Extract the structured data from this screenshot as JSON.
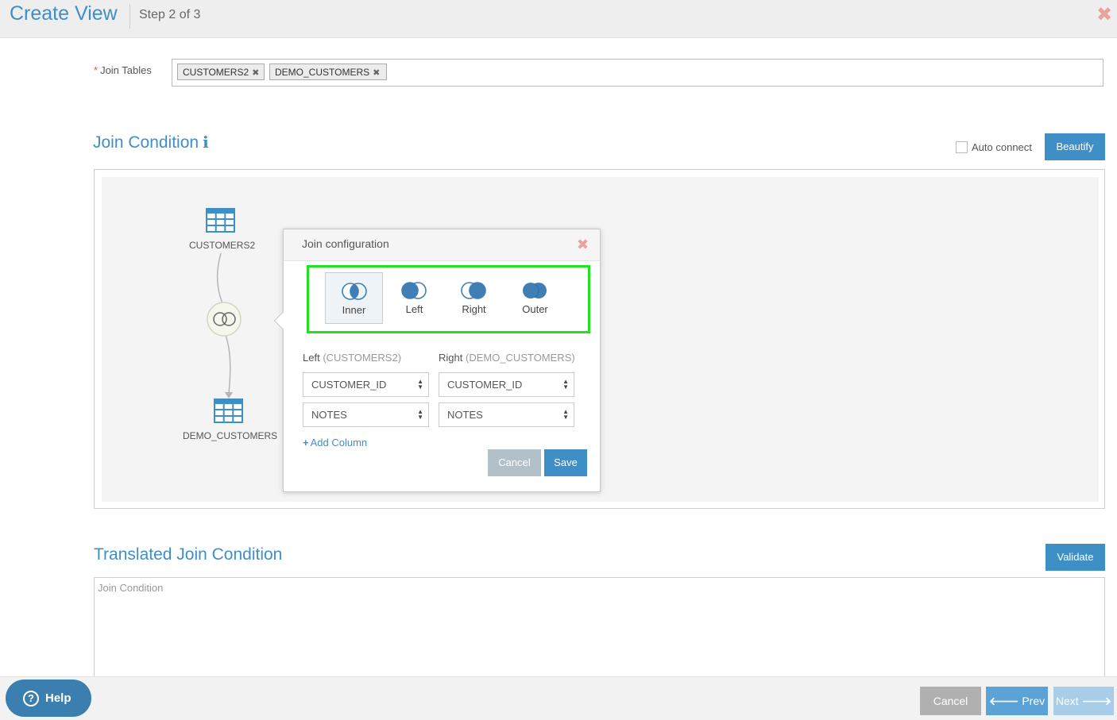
{
  "header": {
    "title": "Create View",
    "step": "Step 2 of 3",
    "close_icon": "close-icon"
  },
  "join_tables": {
    "required_mark": "*",
    "label": "Join Tables",
    "tags": [
      {
        "label": "CUSTOMERS2"
      },
      {
        "label": "DEMO_CUSTOMERS"
      }
    ]
  },
  "join_condition": {
    "title": "Join Condition",
    "auto_connect_label": "Auto connect",
    "auto_connect_checked": false,
    "beautify_label": "Beautify",
    "nodes": {
      "left_table": "CUSTOMERS2",
      "right_table": "DEMO_CUSTOMERS"
    }
  },
  "join_config": {
    "title": "Join configuration",
    "types": [
      {
        "label": "Inner",
        "selected": true
      },
      {
        "label": "Left",
        "selected": false
      },
      {
        "label": "Right",
        "selected": false
      },
      {
        "label": "Outer",
        "selected": false
      }
    ],
    "left_header": "Left",
    "left_table": "(CUSTOMERS2)",
    "right_header": "Right",
    "right_table": "(DEMO_CUSTOMERS)",
    "rows": [
      {
        "left": "CUSTOMER_ID",
        "right": "CUSTOMER_ID"
      },
      {
        "left": "NOTES",
        "right": "NOTES"
      }
    ],
    "add_column_label": "Add Column",
    "cancel_label": "Cancel",
    "save_label": "Save"
  },
  "translated": {
    "title": "Translated Join Condition",
    "validate_label": "Validate",
    "placeholder": "Join Condition"
  },
  "footer": {
    "help_label": "Help",
    "cancel_label": "Cancel",
    "prev_label": "Prev",
    "next_label": "Next"
  },
  "colors": {
    "accent": "#3f8fc7",
    "highlight_border": "#22e022",
    "close": "#e8a39b"
  }
}
